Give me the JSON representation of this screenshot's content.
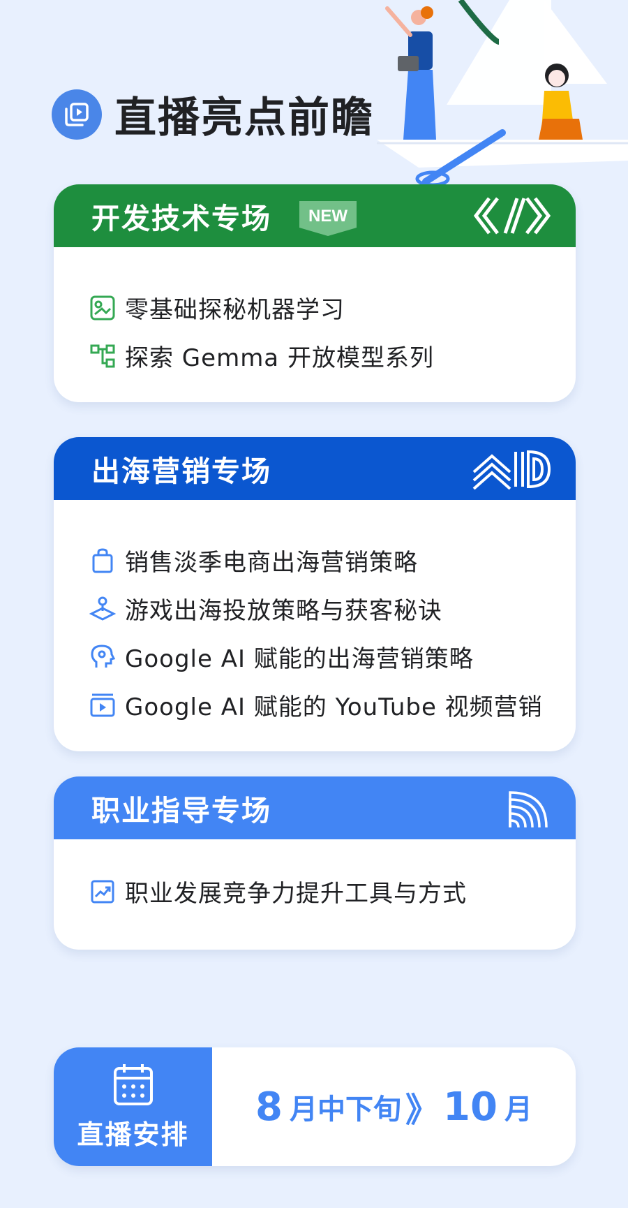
{
  "header": {
    "title": "直播亮点前瞻",
    "icon": "video-library-icon"
  },
  "colors": {
    "background": "#e8f0fe",
    "dev_green": "#1e8e3e",
    "marketing_blue": "#0b57d0",
    "career_blue": "#4285f4",
    "accent_blue": "#4a86e8"
  },
  "sections": {
    "dev": {
      "title": "开发技术专场",
      "badge": "NEW",
      "items": [
        {
          "icon": "machine-learning-icon",
          "label": "零基础探秘机器学习"
        },
        {
          "icon": "model-tree-icon",
          "label": "探索 Gemma 开放模型系列"
        }
      ]
    },
    "marketing": {
      "title": "出海营销专场",
      "items": [
        {
          "icon": "shopping-bag-icon",
          "label": "销售淡季电商出海营销策略"
        },
        {
          "icon": "game-joystick-icon",
          "label": "游戏出海投放策略与获客秘诀"
        },
        {
          "icon": "ai-head-icon",
          "label": "Google AI 赋能的出海营销策略"
        },
        {
          "icon": "video-play-icon",
          "label": "Google AI 赋能的 YouTube 视频营销"
        }
      ]
    },
    "career": {
      "title": "职业指导专场",
      "items": [
        {
          "icon": "trending-up-icon",
          "label": "职业发展竞争力提升工具与方式"
        }
      ]
    }
  },
  "schedule": {
    "label": "直播安排",
    "icon": "calendar-icon",
    "start_num": "8",
    "start_text": "月中下旬",
    "separator": "》",
    "end_num": "10",
    "end_text": "月"
  }
}
